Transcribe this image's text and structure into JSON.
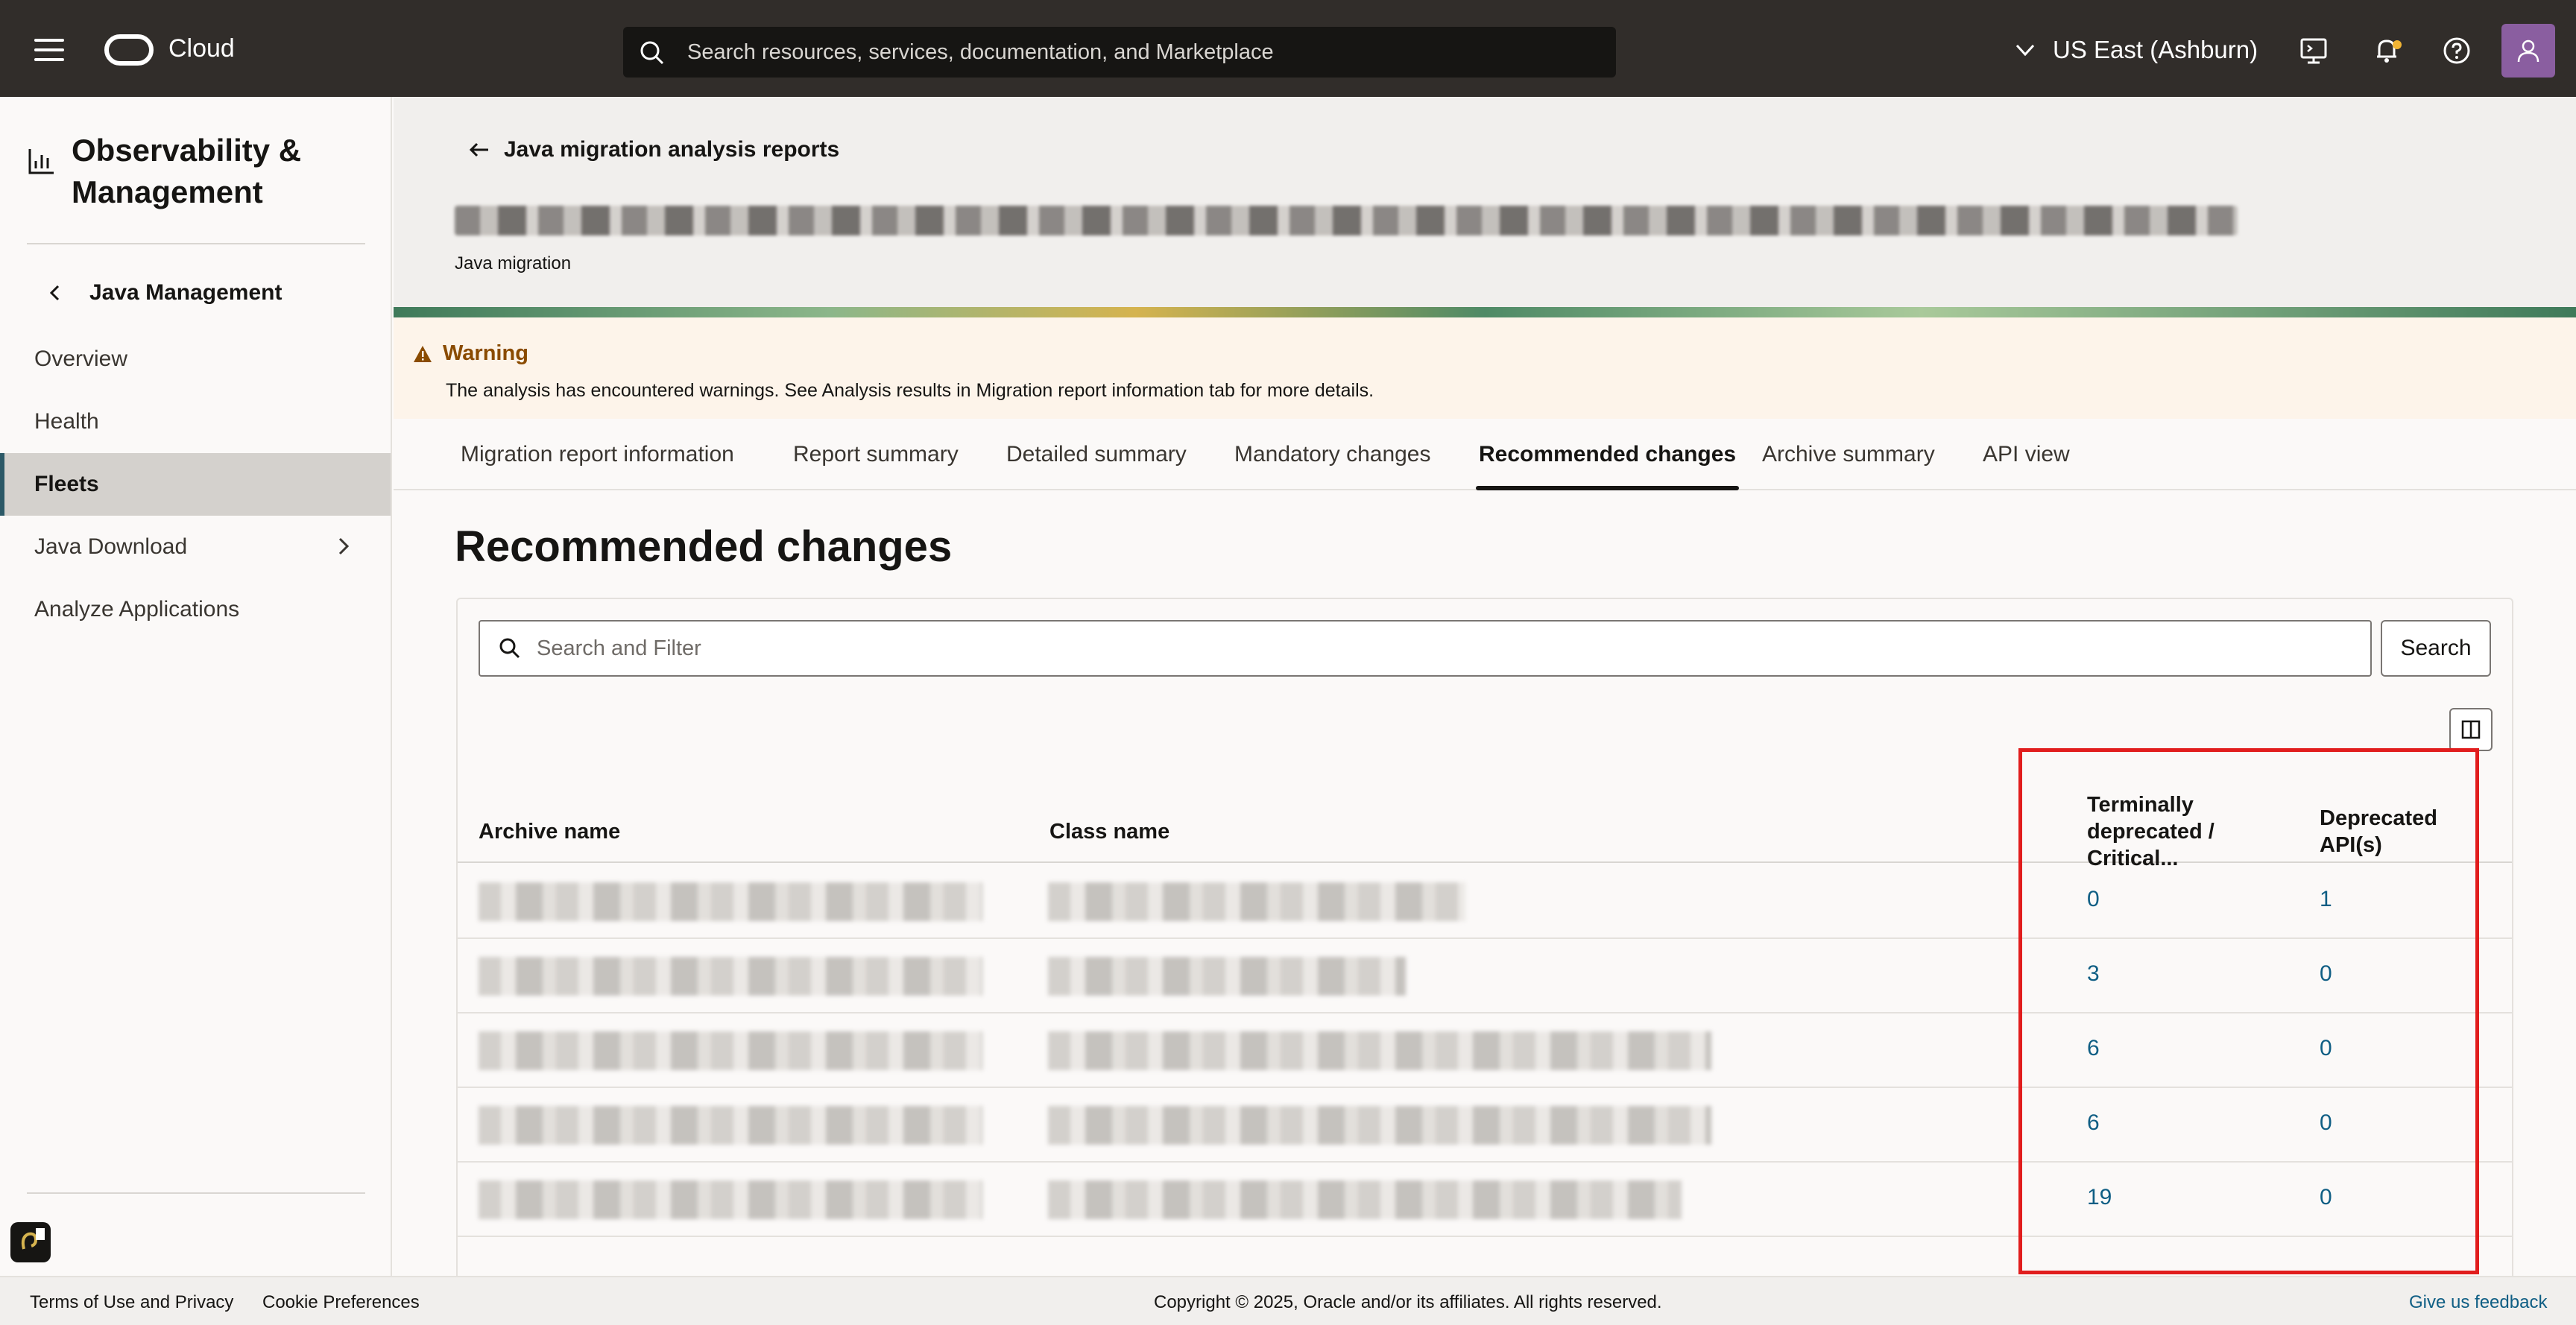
{
  "header": {
    "brand": "Cloud",
    "search_placeholder": "Search resources, services, documentation, and Marketplace",
    "region": "US East (Ashburn)"
  },
  "sidebar": {
    "title_line1": "Observability &",
    "title_line2": "Management",
    "back_label": "Java Management",
    "items": [
      {
        "label": "Overview"
      },
      {
        "label": "Health"
      },
      {
        "label": "Fleets"
      },
      {
        "label": "Java Download"
      },
      {
        "label": "Analyze Applications"
      }
    ]
  },
  "page": {
    "back_label": "Java migration analysis reports",
    "subtitle": "Java migration",
    "warning_title": "Warning",
    "warning_text": "The analysis has encountered warnings. See Analysis results in Migration report information tab for more details.",
    "tabs": [
      "Migration report information",
      "Report summary",
      "Detailed summary",
      "Mandatory changes",
      "Recommended changes",
      "Archive summary",
      "API view"
    ],
    "section_title": "Recommended changes",
    "filter_placeholder": "Search and Filter",
    "search_button": "Search"
  },
  "table": {
    "headers": {
      "archive": "Archive name",
      "class": "Class name",
      "terminal_l1": "Terminally",
      "terminal_l2": "deprecated /",
      "terminal_l3": "Critical...",
      "deprecated_l1": "Deprecated",
      "deprecated_l2": "API(s)"
    },
    "rows": [
      {
        "terminal": "0",
        "deprecated": "1"
      },
      {
        "terminal": "3",
        "deprecated": "0"
      },
      {
        "terminal": "6",
        "deprecated": "0"
      },
      {
        "terminal": "6",
        "deprecated": "0"
      },
      {
        "terminal": "19",
        "deprecated": "0"
      }
    ]
  },
  "footer": {
    "terms": "Terms of Use and Privacy",
    "cookies": "Cookie Preferences",
    "copyright": "Copyright © 2025, Oracle and/or its affiliates. All rights reserved.",
    "feedback": "Give us feedback"
  },
  "colors": {
    "topbar": "#312d2a",
    "link": "#0f5e84",
    "warning": "#8a4b00",
    "highlight": "#e11d1d"
  }
}
